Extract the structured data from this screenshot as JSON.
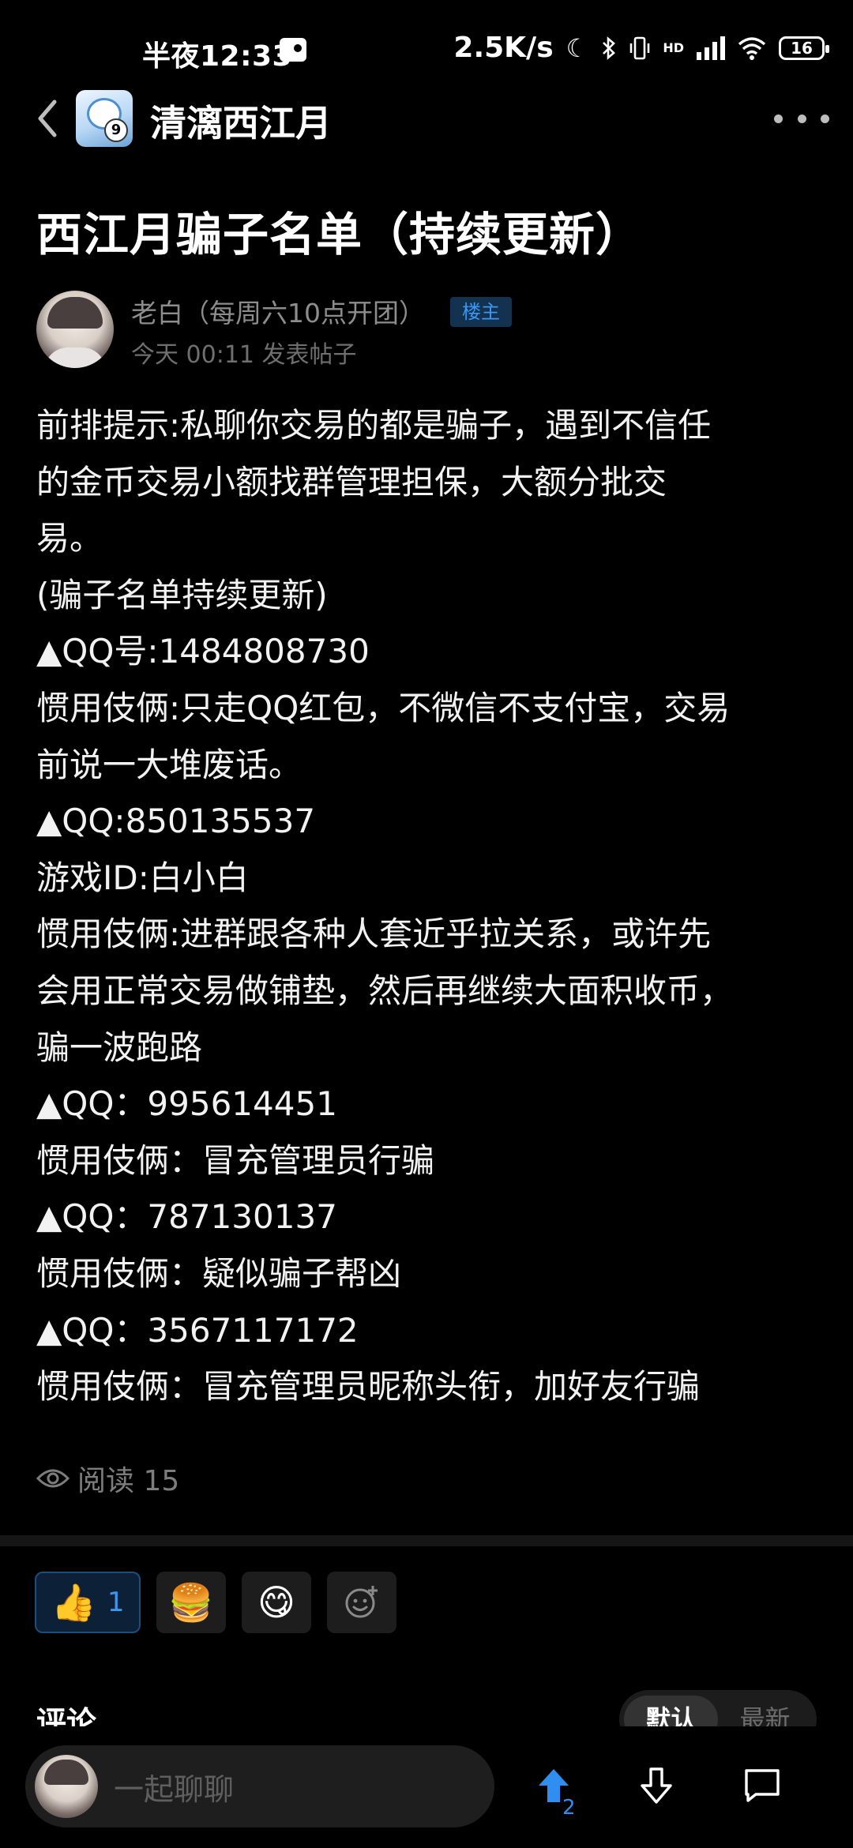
{
  "status_bar": {
    "time": "半夜12:33",
    "speed": "2.5K/s",
    "network": "HD",
    "battery": "16"
  },
  "nav": {
    "group_name": "清漓西江月",
    "avatar_badge": "9"
  },
  "post": {
    "title": "西江月骗子名单（持续更新）",
    "author": "老白（每周六10点开团）",
    "owner_badge": "楼主",
    "meta": "今天 00:11 发表帖子",
    "lines": [
      "前排提示:私聊你交易的都是骗子，遇到不信任",
      "的金币交易小额找群管理担保，大额分批交",
      "易。",
      "(骗子名单持续更新)",
      "▲QQ号:1484808730",
      "惯用伎俩:只走QQ红包，不微信不支付宝，交易",
      "前说一大堆废话。",
      "▲QQ:850135537",
      "游戏ID:白小白",
      "惯用伎俩:进群跟各种人套近乎拉关系，或许先",
      "会用正常交易做铺垫，然后再继续大面积收币，",
      "骗一波跑路",
      "▲QQ：995614451",
      "惯用伎俩：冒充管理员行骗",
      "▲QQ：787130137",
      "惯用伎俩：疑似骗子帮凶",
      "▲QQ：3567117172",
      "惯用伎俩：冒充管理员昵称头衔，加好友行骗"
    ],
    "read_label": "阅读 15"
  },
  "reactions": {
    "like_emoji": "👍",
    "like_count": "1",
    "burger_emoji": "🍔",
    "yum_emoji": "😋",
    "add_icon": "add-emoji-icon"
  },
  "comments": {
    "header": "评论",
    "sort_default": "默认",
    "sort_latest": "最新"
  },
  "bottom_bar": {
    "placeholder": "一起聊聊",
    "upvote_count": "2"
  },
  "colors": {
    "accent": "#2f8ef0",
    "background": "#000000",
    "muted_text": "#8d8d8d"
  }
}
